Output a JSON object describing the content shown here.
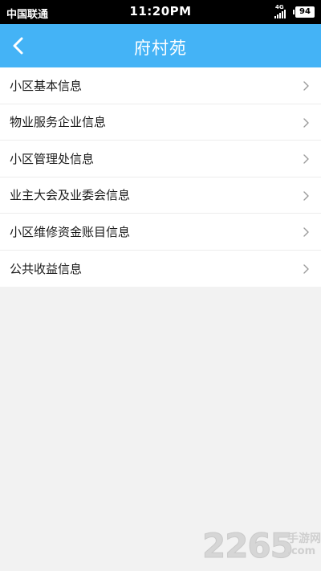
{
  "status_bar": {
    "carrier": "中国联通",
    "time": "11:20PM",
    "network": "4G",
    "battery": "94"
  },
  "nav": {
    "title": "府村苑",
    "back_icon": "chevron-left-icon"
  },
  "menu": {
    "items": [
      {
        "label": "小区基本信息"
      },
      {
        "label": "物业服务企业信息"
      },
      {
        "label": "小区管理处信息"
      },
      {
        "label": "业主大会及业委会信息"
      },
      {
        "label": "小区维修资金账目信息"
      },
      {
        "label": "公共收益信息"
      }
    ],
    "item_icon": "chevron-right-icon"
  },
  "watermark": {
    "digits": "2265",
    "text": "手游网",
    "domain": ".com"
  },
  "colors": {
    "accent": "#44b3f6",
    "background": "#f2f2f2",
    "status_bar": "#000000"
  }
}
